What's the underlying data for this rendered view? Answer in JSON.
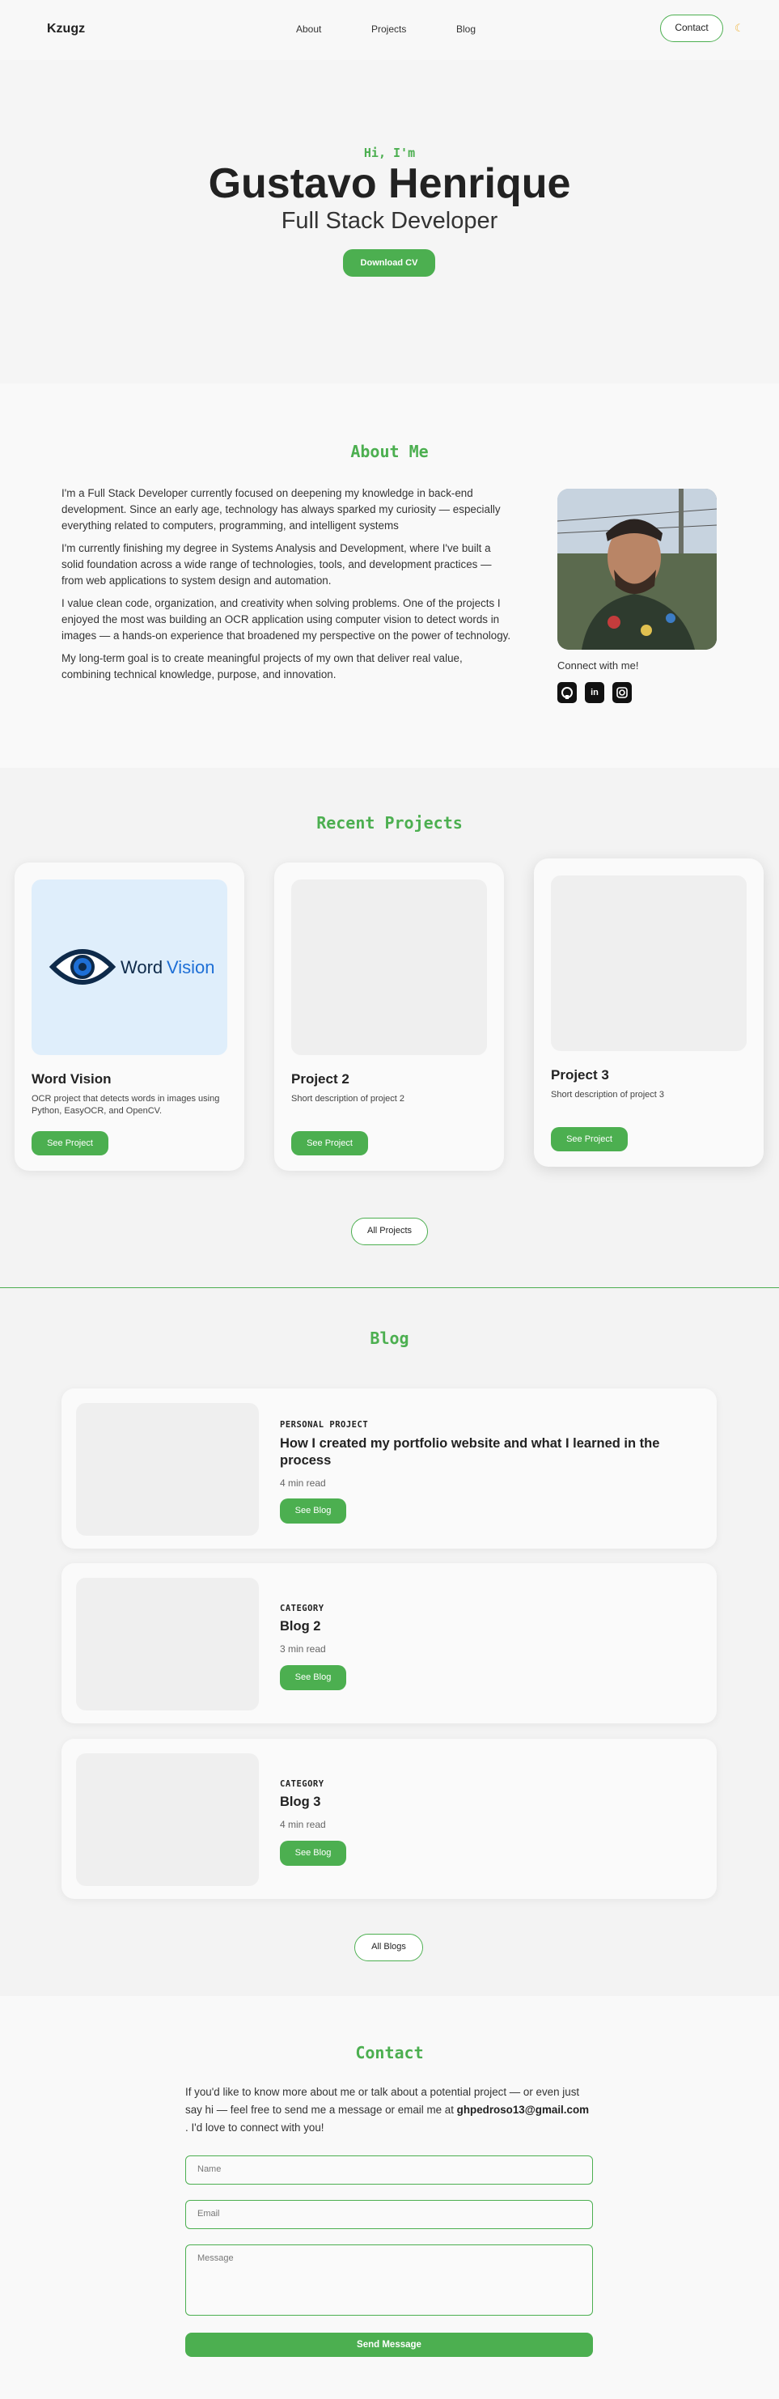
{
  "nav": {
    "logo": "Kzugz",
    "links": [
      "About",
      "Projects",
      "Blog"
    ],
    "contact_label": "Contact",
    "theme_icon": "moon-icon"
  },
  "hero": {
    "greeting": "Hi, I'm",
    "name": "Gustavo Henrique",
    "role": "Full Stack Developer",
    "download_label": "Download CV"
  },
  "about": {
    "title": "About Me",
    "paragraphs": [
      "I'm a Full Stack Developer currently focused on deepening my knowledge in back-end development. Since an early age, technology has always sparked my curiosity — especially everything related to computers, programming, and intelligent systems",
      "I'm currently finishing my degree in Systems Analysis and Development, where I've built a solid foundation across a wide range of technologies, tools, and development practices — from web applications to system design and automation.",
      "I value clean code, organization, and creativity when solving problems. One of the projects I enjoyed the most was building an OCR application using computer vision to detect words in images — a hands-on experience that broadened my perspective on the power of technology.",
      "My long-term goal is to create meaningful projects of my own that deliver real value, combining technical knowledge, purpose, and innovation."
    ],
    "connect_label": "Connect with me!",
    "socials": [
      "github-icon",
      "linkedin-icon",
      "instagram-icon"
    ]
  },
  "projects": {
    "title": "Recent Projects",
    "cards": [
      {
        "title": "Word Vision",
        "description": "OCR project that detects words in images using Python, EasyOCR, and OpenCV.",
        "button": "See Project",
        "logo_text_a": "Word",
        "logo_text_b": "Vision"
      },
      {
        "title": "Project 2",
        "description": "Short description of project 2",
        "button": "See Project"
      },
      {
        "title": "Project 3",
        "description": "Short description of project 3",
        "button": "See Project"
      }
    ],
    "all_label": "All Projects"
  },
  "blog": {
    "title": "Blog",
    "posts": [
      {
        "category": "PERSONAL PROJECT",
        "title": "How I created my portfolio website and what I learned in the process",
        "read": "4 min read",
        "button": "See Blog"
      },
      {
        "category": "CATEGORY",
        "title": "Blog 2",
        "read": "3 min read",
        "button": "See Blog"
      },
      {
        "category": "CATEGORY",
        "title": "Blog 3",
        "read": "4 min read",
        "button": "See Blog"
      }
    ],
    "all_label": "All Blogs"
  },
  "contact": {
    "title": "Contact",
    "text_before": "If you'd like to know more about me or talk about a potential project — or even just say hi — feel free to send me a message or email me at ",
    "email": "ghpedroso13@gmail.com",
    "text_after": " . I'd love to connect with you!",
    "name_placeholder": "Name",
    "email_placeholder": "Email",
    "message_placeholder": "Message",
    "send_label": "Send Message"
  },
  "colors": {
    "accent": "#4caf50"
  }
}
